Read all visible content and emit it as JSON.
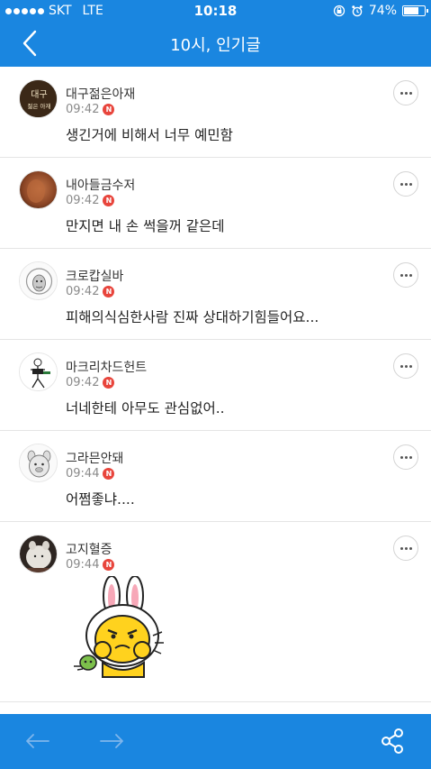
{
  "status_bar": {
    "carrier": "SKT",
    "network": "LTE",
    "time": "10:18",
    "battery": "74%",
    "battery_level": 0.74,
    "icons": [
      "rotation-lock-icon",
      "alarm-icon"
    ]
  },
  "header": {
    "title": "10시, 인기글",
    "back_icon": "chevron-left-icon",
    "background_color": "#1a86e0"
  },
  "posts": [
    {
      "author": "대구젊은아재",
      "time": "09:42",
      "badge": "N",
      "content": "생긴거에 비해서 너무 예민함",
      "avatar_text_top": "대구",
      "avatar_text_bottom": "젊은 아재"
    },
    {
      "author": "내아들금수저",
      "time": "09:42",
      "badge": "N",
      "content": "만지면 내 손 썩을꺼 같은데"
    },
    {
      "author": "크로캅실바",
      "time": "09:42",
      "badge": "N",
      "content": "피해의식심한사람 진짜 상대하기힘들어요..."
    },
    {
      "author": "마크리차드헌트",
      "time": "09:42",
      "badge": "N",
      "content": "너네한테 아무도 관심없어.."
    },
    {
      "author": "그라믄안돼",
      "time": "09:44",
      "badge": "N",
      "content": "어쩜좋냐...."
    },
    {
      "author": "고지혈증",
      "time": "09:44",
      "badge": "N",
      "content": "",
      "sticker": "rabbit-sticker"
    }
  ],
  "bottom_bar": {
    "prev_icon": "arrow-left-icon",
    "next_icon": "arrow-right-icon",
    "share_icon": "share-icon"
  },
  "colors": {
    "accent": "#1a86e0",
    "badge": "#e8453c"
  }
}
